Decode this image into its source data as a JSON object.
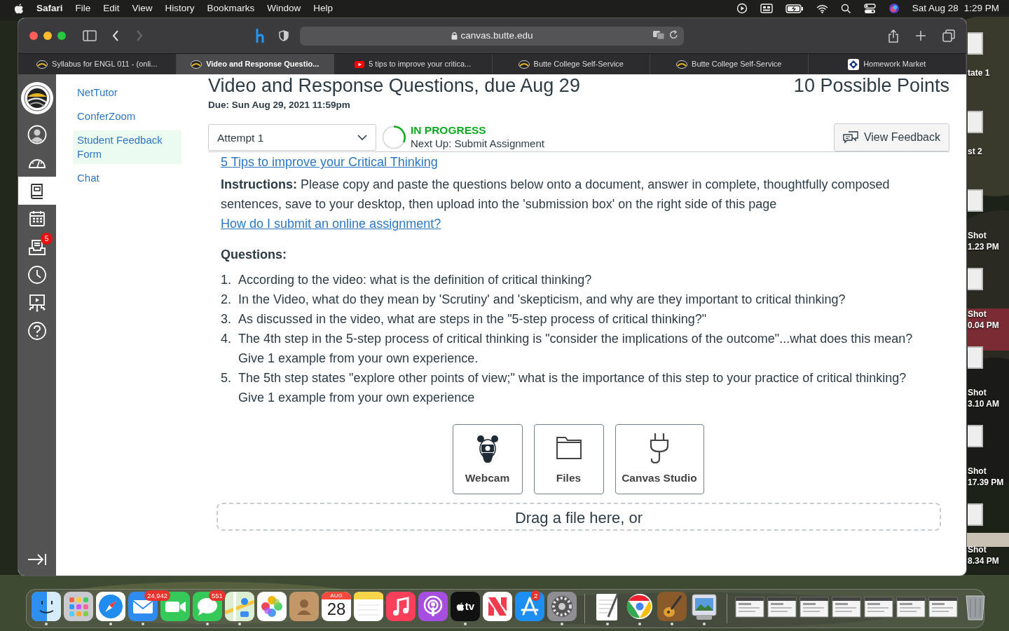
{
  "menu_bar": {
    "app": "Safari",
    "menus": [
      "File",
      "Edit",
      "View",
      "History",
      "Bookmarks",
      "Window",
      "Help"
    ],
    "date": "Sat Aug 28",
    "time": "1:29 PM"
  },
  "browser": {
    "nav_buttons": [
      {
        "kind": "back",
        "disabled": false
      },
      {
        "kind": "forward",
        "disabled": true
      }
    ],
    "address": "canvas.butte.edu",
    "tabs": [
      {
        "title": "Syllabus for ENGL 011 - (onli...",
        "kind": "college",
        "selected": false
      },
      {
        "title": "Video and Response Questio...",
        "kind": "college",
        "selected": true
      },
      {
        "title": "5 tips to improve your critica...",
        "kind": "video",
        "selected": false
      },
      {
        "title": "Butte College Self-Service",
        "kind": "college",
        "selected": false
      },
      {
        "title": "Butte College Self-Service",
        "kind": "college",
        "selected": false
      },
      {
        "title": "Homework Market",
        "kind": "homework",
        "selected": false
      }
    ]
  },
  "global_nav": [
    {
      "kind": "account",
      "selected": false
    },
    {
      "kind": "dashboard",
      "selected": false
    },
    {
      "kind": "courses",
      "selected": true
    },
    {
      "kind": "calendar",
      "selected": false
    },
    {
      "kind": "inbox",
      "selected": false,
      "badge": "5"
    },
    {
      "kind": "history",
      "selected": false
    },
    {
      "kind": "studio",
      "selected": false
    },
    {
      "kind": "help",
      "selected": false
    }
  ],
  "course_nav": [
    {
      "label": "NetTutor",
      "selected": false
    },
    {
      "label": "ConferZoom",
      "selected": false
    },
    {
      "label": "Student Feedback Form",
      "selected": true
    },
    {
      "label": "Chat",
      "selected": false
    }
  ],
  "assignment": {
    "title": "Video and Response Questions, due Aug 29",
    "points": "10 Possible Points",
    "due": "Due: Sun Aug 29, 2021 11:59pm",
    "attempt": "Attempt 1",
    "status": "IN PROGRESS",
    "next_up": "Next Up: Submit Assignment",
    "feedback_button": "View Feedback",
    "video_link": "5 Tips to improve your Critical Thinking",
    "instructions": "**Instructions:** Please copy and paste the questions below onto a document, answer in complete, thoughtfully composed sentences, save to your desktop, then upload into the 'submission box' on the right side of this page",
    "help_link": "How do I submit an online assignment?",
    "questions_heading": "Questions:",
    "questions": [
      {
        "number": "1.",
        "text": "According to the video: what is the definition of critical thinking?"
      },
      {
        "number": "2.",
        "text": "In the Video, what do they mean by 'Scrutiny' and 'skepticism, and why are they important to critical thinking?"
      },
      {
        "number": "3.",
        "text": "As discussed in the video, what are steps in the \"5-step process of critical thinking?\""
      },
      {
        "number": "4.",
        "text": "The 4th step in the 5-step process of critical thinking is \"consider the implications of the outcome\"...what does this mean? Give 1 example from your own experience."
      },
      {
        "number": "5.",
        "text": "The 5th step states \"explore other points of view;\" what is the importance of this step to your practice of critical thinking? Give 1 example from your own experience"
      }
    ]
  },
  "upload": {
    "options": [
      {
        "kind": "webcam",
        "label": "Webcam"
      },
      {
        "kind": "files",
        "label": "Files"
      },
      {
        "kind": "studio",
        "label": "Canvas Studio"
      }
    ],
    "dropzone_text": "Drag a file here, or"
  },
  "desktop_icons": [
    {
      "label": "tate 1"
    },
    {
      "label": "st 2"
    },
    {
      "label": "Shot\n1.23 PM"
    },
    {
      "label": "Shot\n0.04 PM"
    },
    {
      "label": "Shot\n3.10 AM"
    },
    {
      "label": "Shot\n17.39 PM"
    },
    {
      "label": "Shot\n8.34 PM"
    }
  ],
  "dock": [
    {
      "kind": "finder",
      "running": true
    },
    {
      "kind": "launchpad",
      "running": false
    },
    {
      "kind": "safari",
      "running": true
    },
    {
      "kind": "mail",
      "running": true,
      "badge": "24,942"
    },
    {
      "kind": "facetime",
      "running": false
    },
    {
      "kind": "messages",
      "running": true,
      "badge": "551"
    },
    {
      "kind": "maps",
      "running": true
    },
    {
      "kind": "photos",
      "running": false
    },
    {
      "kind": "contacts",
      "running": false
    },
    {
      "kind": "calendar",
      "running": false,
      "month": "AUG",
      "day": "28"
    },
    {
      "kind": "notes",
      "running": false
    },
    {
      "kind": "music",
      "running": false
    },
    {
      "kind": "podcasts",
      "running": false
    },
    {
      "kind": "tv",
      "running": true,
      "label": "tv"
    },
    {
      "kind": "news",
      "running": false
    },
    {
      "kind": "appstore",
      "running": false,
      "badge": "2"
    },
    {
      "kind": "settings",
      "running": true
    },
    {
      "kind": "divider"
    },
    {
      "kind": "textedit",
      "running": true
    },
    {
      "kind": "chrome",
      "running": true
    },
    {
      "kind": "garageband",
      "running": true
    },
    {
      "kind": "preview",
      "running": true
    },
    {
      "kind": "divider"
    },
    {
      "kind": "minimized"
    },
    {
      "kind": "minimized"
    },
    {
      "kind": "minimized"
    },
    {
      "kind": "minimized"
    },
    {
      "kind": "minimized"
    },
    {
      "kind": "minimized"
    },
    {
      "kind": "minimized"
    },
    {
      "kind": "trash"
    }
  ]
}
